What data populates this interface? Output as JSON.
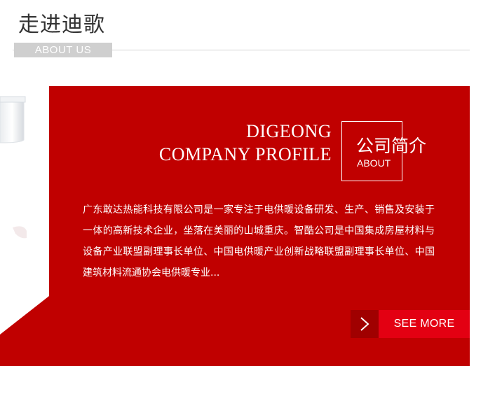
{
  "header": {
    "title": "走进迪歌",
    "tag": "ABOUT US"
  },
  "profile": {
    "heading_line1": "DIGEONG",
    "heading_line2": "COMPANY PROFILE",
    "badge_cn": "公司简介",
    "badge_en": "ABOUT",
    "description": "广东敢达热能科技有限公司是一家专注于电供暖设备研发、生产、销售及安装于一体的高新技术企业，坐落在美丽的山城重庆。智酷公司是中国集成房屋材料与设备产业联盟副理事长单位、中国电供暖产业创新战略联盟副理事长单位、中国建筑材料流通协会电供暖专业...",
    "see_more": "SEE MORE"
  },
  "colors": {
    "panel_red": "#c00000",
    "button_red": "#e30012",
    "arrow_bg": "#a00000",
    "tag_gray": "#cfcfcf"
  },
  "icons": {
    "arrow": "chevron-right-icon"
  }
}
